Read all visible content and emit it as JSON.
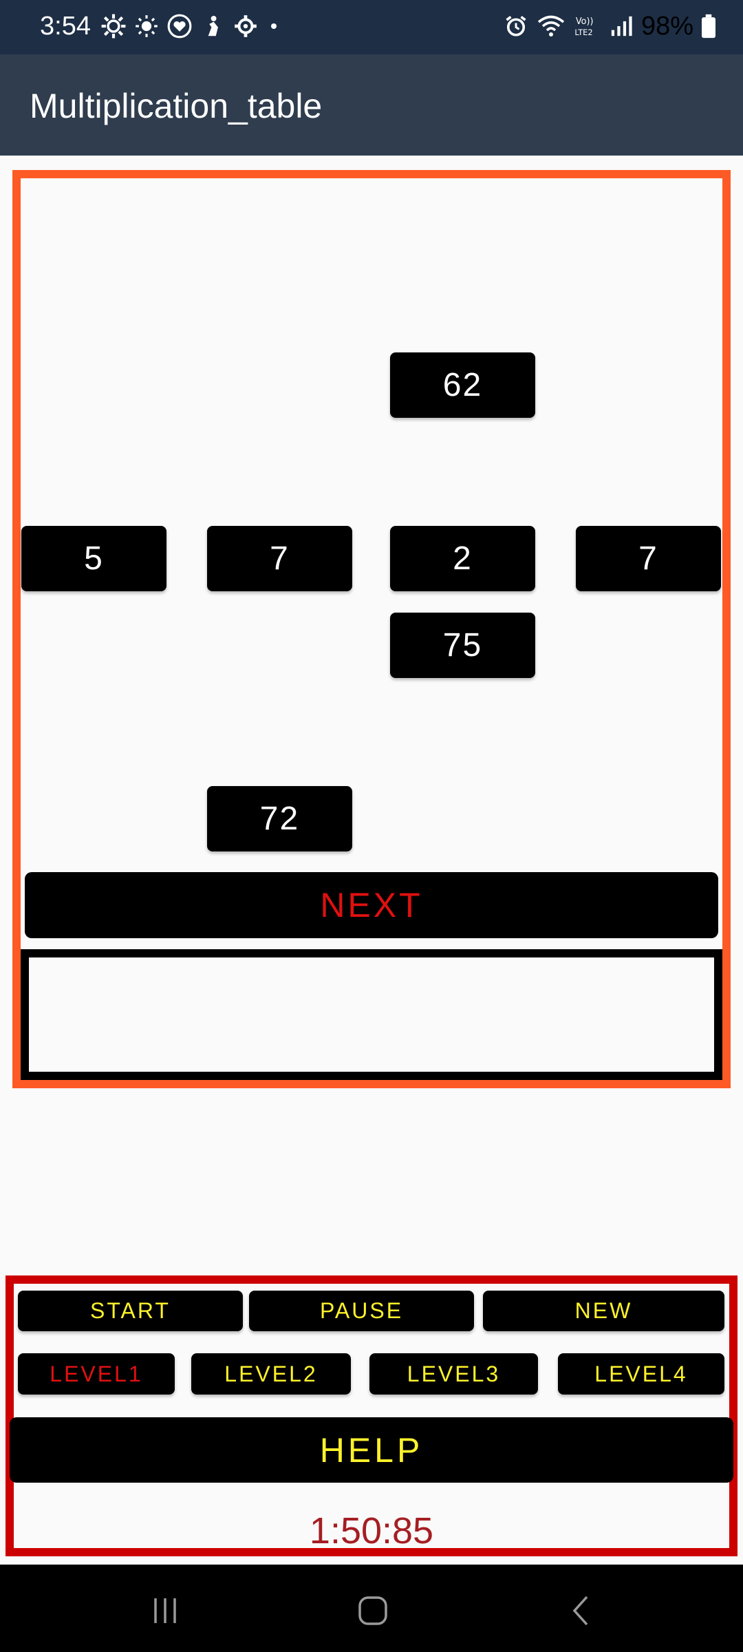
{
  "status_bar": {
    "time": "3:54",
    "battery": "98%"
  },
  "app_bar": {
    "title": "Multiplication_table"
  },
  "board": {
    "tiles": [
      {
        "value": "62"
      },
      {
        "value": "5"
      },
      {
        "value": "7"
      },
      {
        "value": "2"
      },
      {
        "value": "7"
      },
      {
        "value": "75"
      },
      {
        "value": "72"
      }
    ],
    "next_label": "NEXT",
    "answer_text": ""
  },
  "controls": {
    "start": "START",
    "pause": "PAUSE",
    "new": "NEW",
    "level1": "LEVEL1",
    "level2": "LEVEL2",
    "level3": "LEVEL3",
    "level4": "LEVEL4",
    "help": "HELP",
    "timer": "1:50:85"
  },
  "colors": {
    "board_border": "#fe5a26",
    "controls_border": "#cc0000",
    "button_text": "#fdf22a",
    "selected_level_text": "#e01010",
    "next_text": "#e01010",
    "timer_text": "#a51e22"
  }
}
